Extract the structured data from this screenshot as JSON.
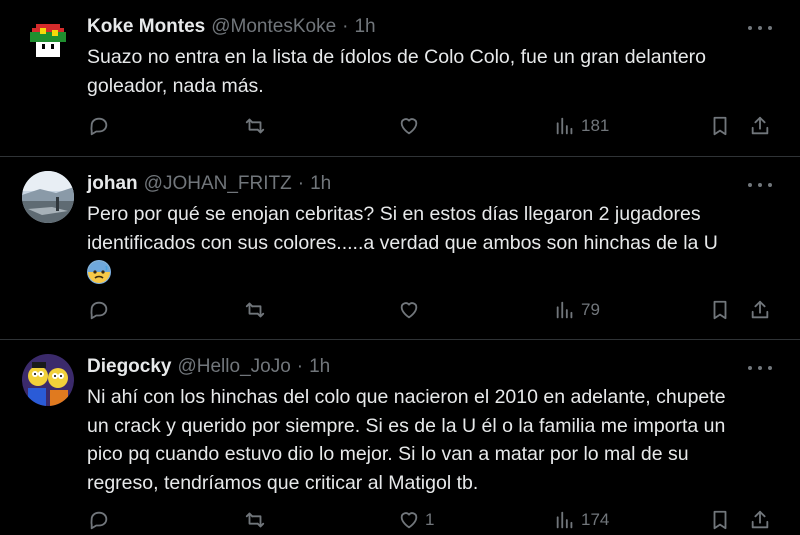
{
  "tweets": [
    {
      "name": "Koke Montes",
      "handle": "@MontesKoke",
      "sep": "·",
      "time": "1h",
      "lines": [
        "Suazo no entra en la lista de ídolos de Colo Colo, fue un gran delantero",
        "goleador, nada más."
      ],
      "likes": "",
      "views": "181",
      "avatar": "mushroom-avatar"
    },
    {
      "name": "johan",
      "handle": "@JOHAN_FRITZ",
      "sep": "·",
      "time": "1h",
      "lines": [
        "Pero por qué se enojan cebritas? Si en estos días llegaron 2 jugadores",
        "identificados con sus colores.....a verdad que ambos son hinchas de la U"
      ],
      "emoji": "anxious-face-emoji",
      "likes": "",
      "views": "79",
      "avatar": "landscape-avatar"
    },
    {
      "name": "Diegocky",
      "handle": "@Hello_JoJo",
      "sep": "·",
      "time": "1h",
      "lines": [
        "Ni ahí con los hinchas del colo que nacieron el 2010 en adelante, chupete",
        "un crack y querido por siempre. Si es de la U él o la familia me importa un",
        "pico pq cuando estuvo dio lo mejor. Si lo van a matar por lo mal de su",
        "regreso, tendríamos que criticar al Matigol tb."
      ],
      "likes": "1",
      "views": "174",
      "avatar": "cartoon-avatar"
    }
  ],
  "colors": {
    "background": "#000000",
    "text": "#e7e9ea",
    "muted": "#71767b",
    "divider": "#2f3336"
  }
}
